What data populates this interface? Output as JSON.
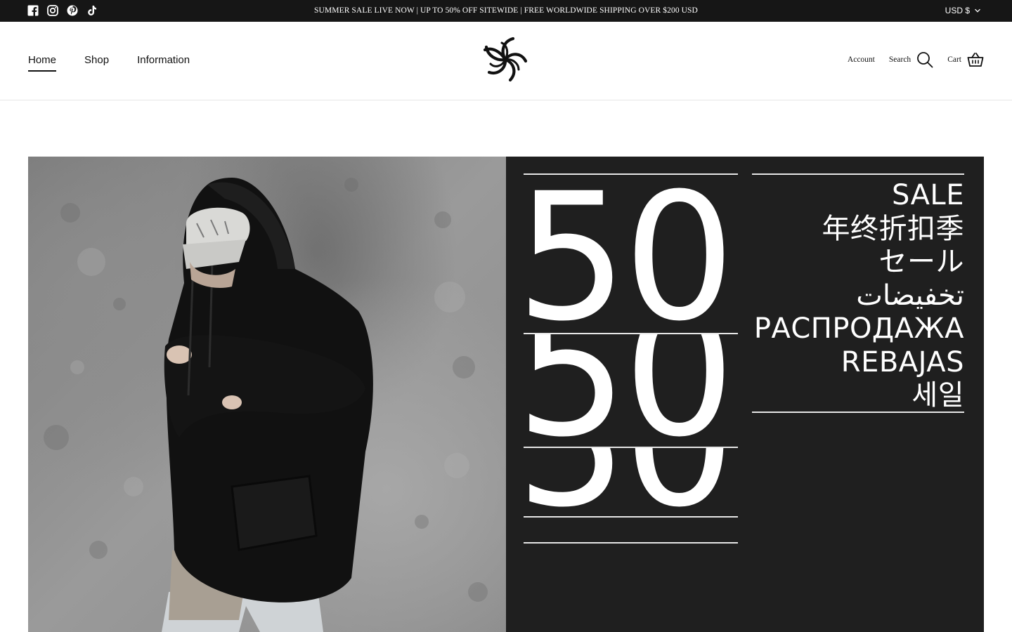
{
  "announcement": {
    "text": "SUMMER SALE LIVE NOW | UP TO 50% OFF SITEWIDE | FREE WORLDWIDE SHIPPING OVER $200 USD",
    "currency": "USD $",
    "social_icons": [
      "facebook-icon",
      "instagram-icon",
      "pinterest-icon",
      "tiktok-icon"
    ]
  },
  "header": {
    "nav": [
      {
        "label": "Home",
        "active": true
      },
      {
        "label": "Shop",
        "active": false
      },
      {
        "label": "Information",
        "active": false
      }
    ],
    "account_label": "Account",
    "search_label": "Search",
    "cart_label": "Cart"
  },
  "hero": {
    "big_number": "50",
    "sale_words": [
      "SALE",
      "年终折扣季",
      "セール",
      "تخفيضات",
      "РАСПРОДАЖА",
      "REBAJAS",
      "세일"
    ]
  },
  "colors": {
    "announcement_bg": "#161616",
    "promo_bg": "#1f1f1f",
    "text": "#111111"
  }
}
